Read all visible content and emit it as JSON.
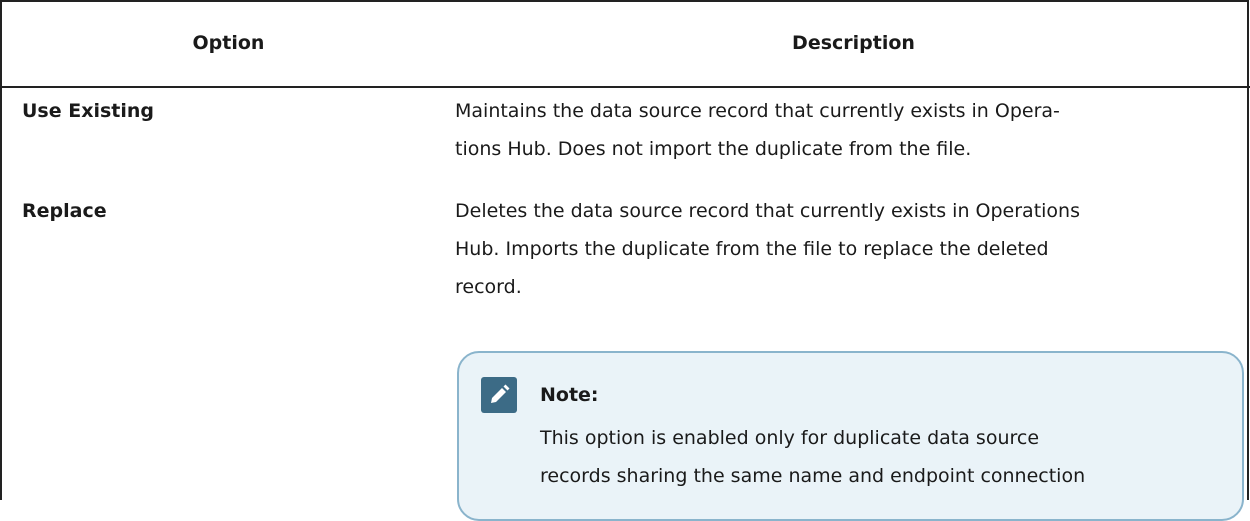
{
  "table": {
    "headers": {
      "option": "Option",
      "description": "Description"
    },
    "rows": [
      {
        "option": "Use Existing",
        "description_lines": [
          "Maintains the data source record that currently exists in Opera-",
          "tions Hub. Does not import the duplicate from the file."
        ]
      },
      {
        "option": "Replace",
        "description_lines": [
          "Deletes the data source record that currently exists in Operations",
          "Hub. Imports the duplicate from the file to replace the deleted",
          "record."
        ]
      }
    ]
  },
  "note": {
    "icon": "pencil-note-icon",
    "title": "Note:",
    "lines": [
      "This option is enabled only for duplicate data source",
      "records sharing the same name and endpoint connection"
    ]
  },
  "colors": {
    "note_background": "#eaf3f8",
    "note_border": "#8ab4cc",
    "icon_background": "#3c6b86"
  }
}
